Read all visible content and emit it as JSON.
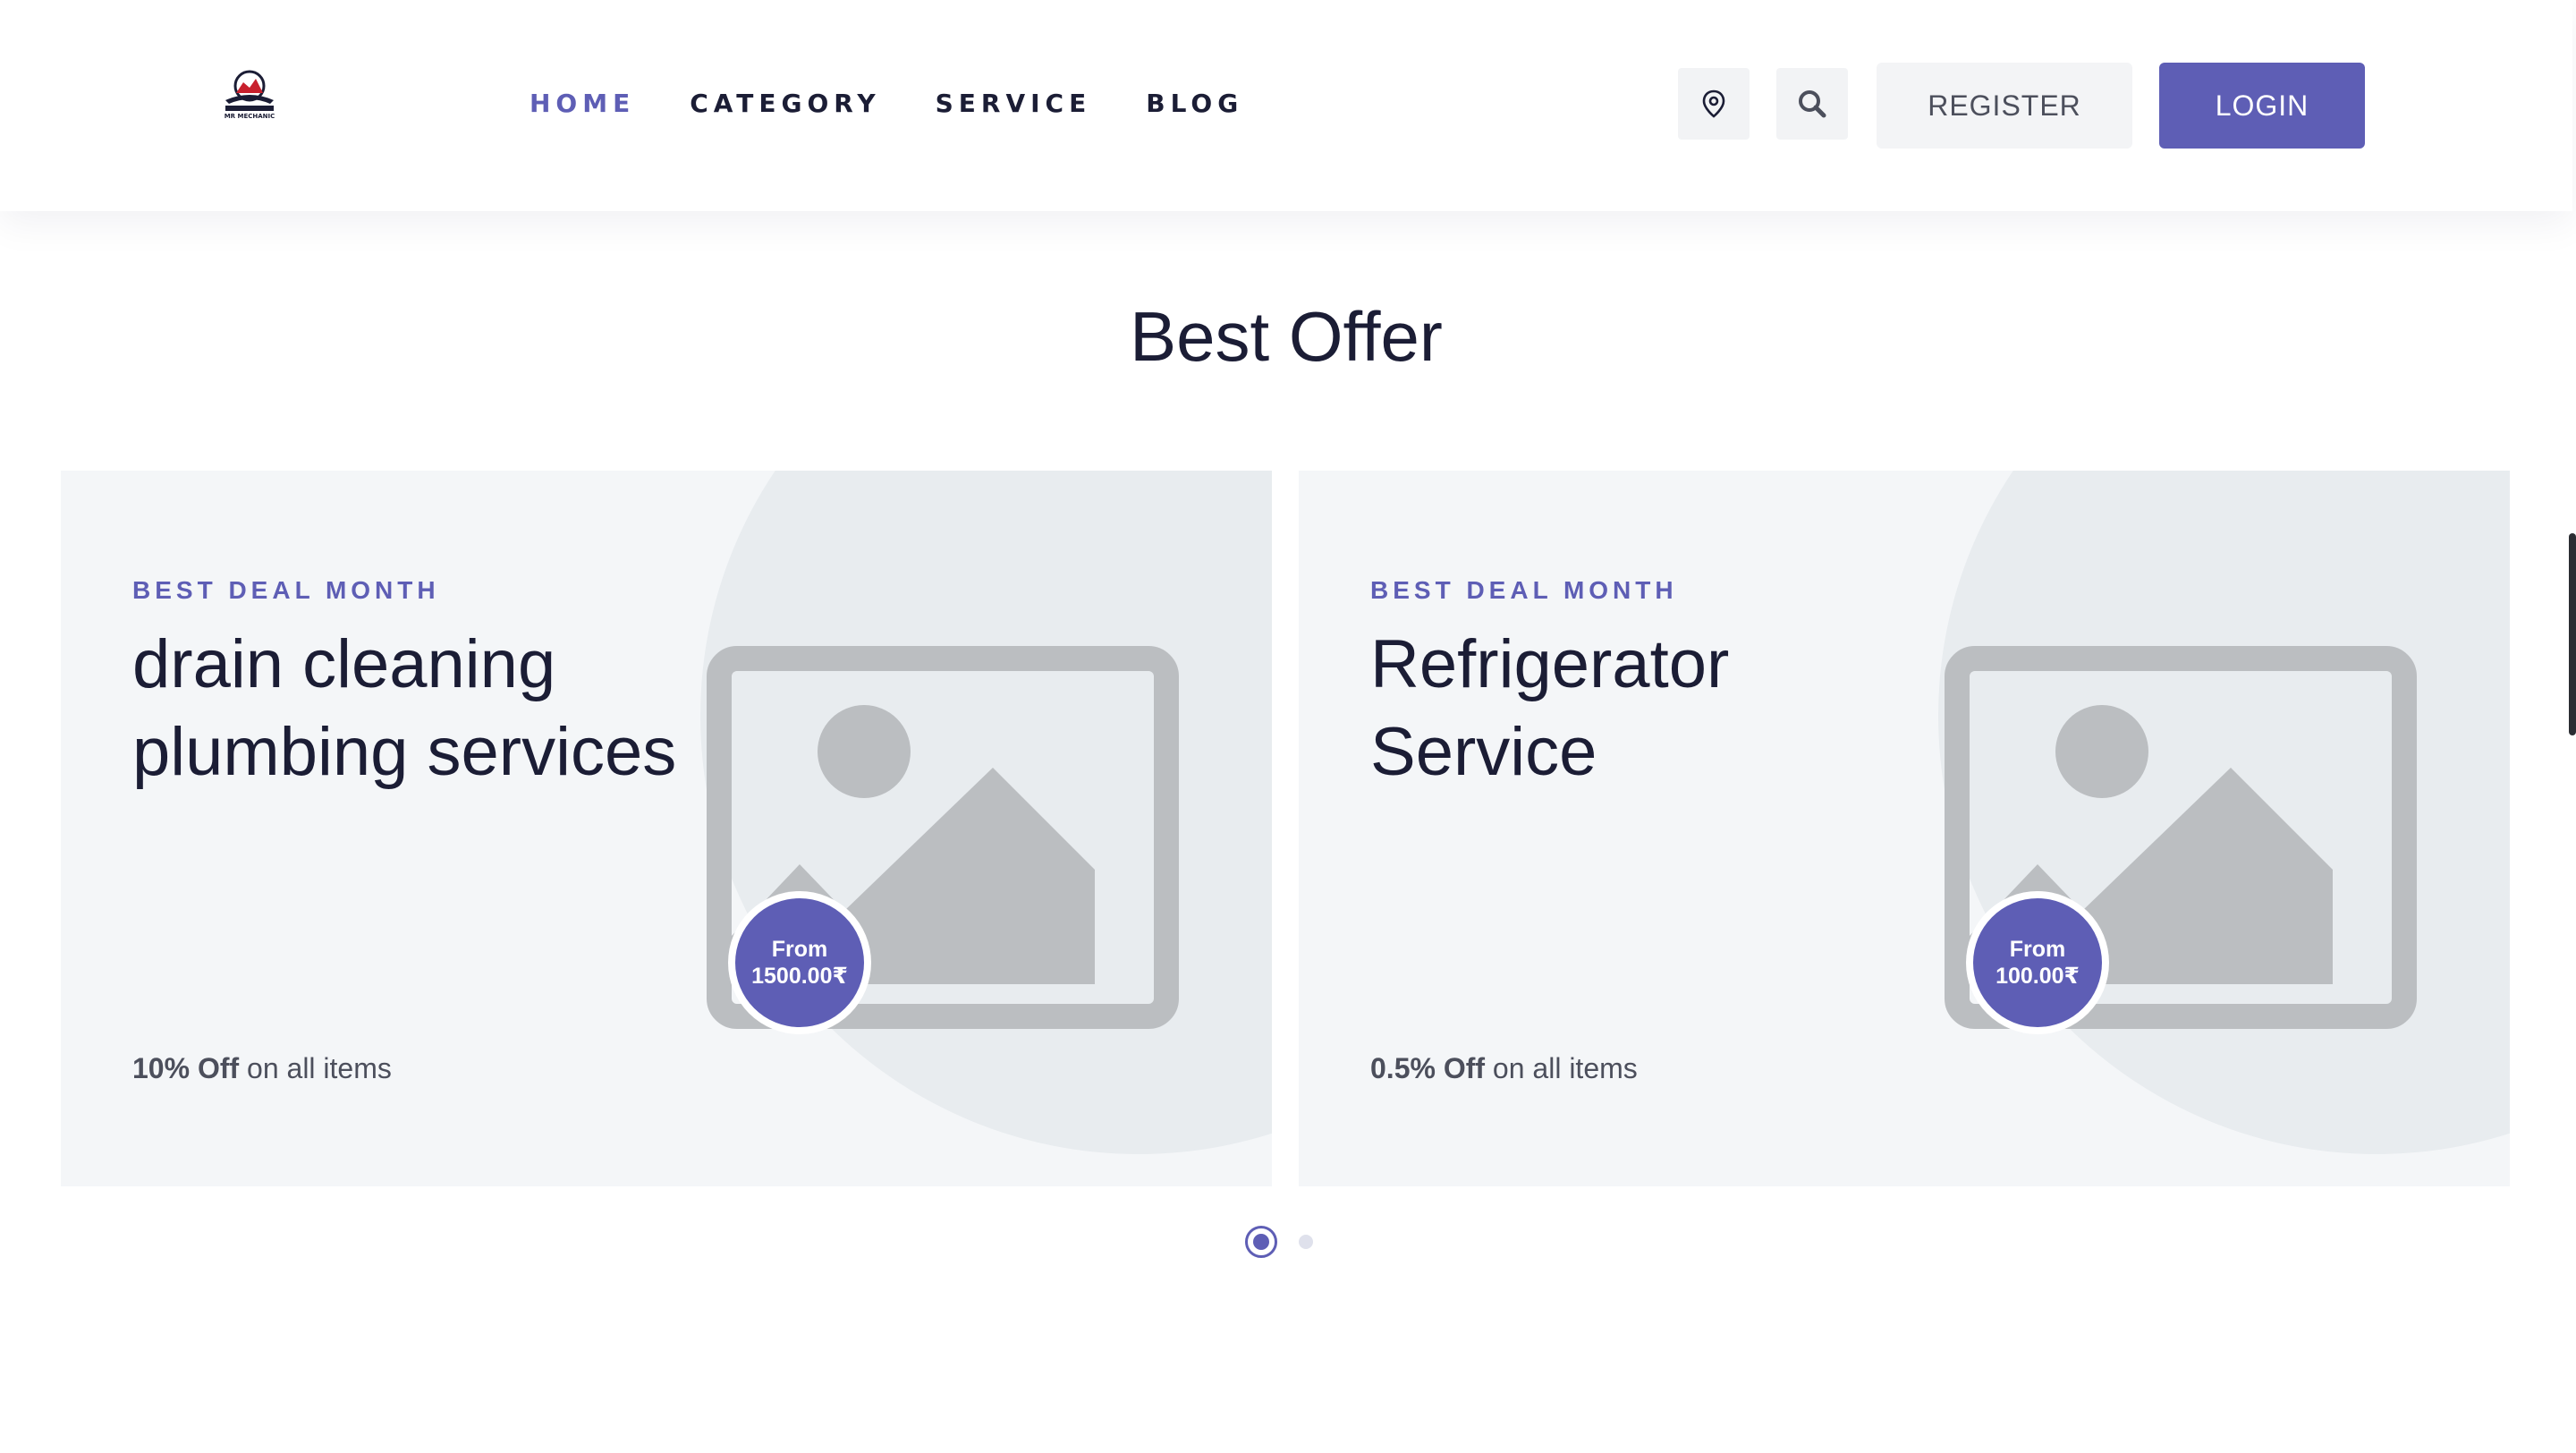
{
  "header": {
    "logo_text": "MR MECHANIC",
    "nav": [
      {
        "label": "HOME",
        "active": true
      },
      {
        "label": "CATEGORY",
        "active": false
      },
      {
        "label": "SERVICE",
        "active": false
      },
      {
        "label": "BLOG",
        "active": false
      }
    ],
    "location_icon": "map-pin-icon",
    "search_icon": "search-icon",
    "register_label": "REGISTER",
    "login_label": "LOGIN"
  },
  "section": {
    "title": "Best Offer"
  },
  "offers": [
    {
      "eyebrow": "BEST DEAL MONTH",
      "title_line1": "drain cleaning",
      "title_line2": "plumbing services",
      "price_from": "From",
      "price": "1500.00₹",
      "discount_bold": "10% Off",
      "discount_rest": " on all items",
      "image_icon": "image-placeholder-icon"
    },
    {
      "eyebrow": "BEST DEAL MONTH",
      "title_line1": "Refrigerator",
      "title_line2": "Service",
      "price_from": "From",
      "price": "100.00₹",
      "discount_bold": "0.5% Off",
      "discount_rest": " on all items",
      "image_icon": "image-placeholder-icon"
    }
  ],
  "carousel": {
    "pages": 2,
    "active": 1
  },
  "colors": {
    "accent": "#5e5eb5",
    "text_dark": "#1b1d35",
    "card_bg": "#f4f6f8",
    "placeholder": "#bbbec1"
  }
}
